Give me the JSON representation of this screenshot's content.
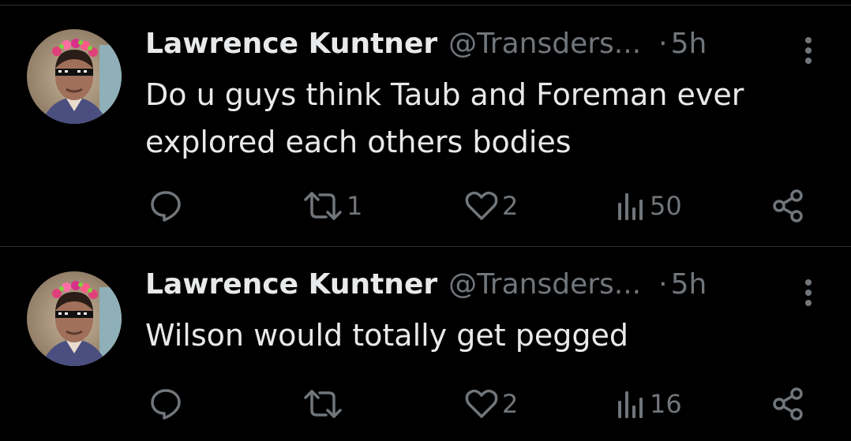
{
  "tweets": [
    {
      "name": "Lawrence Kuntner",
      "handle": "@Transders...",
      "separator": "·",
      "time": "5h",
      "text": "Do u guys think Taub and Foreman ever explored each others bodies",
      "retweets": "1",
      "likes": "2",
      "views": "50"
    },
    {
      "name": "Lawrence Kuntner",
      "handle": "@Transders...",
      "separator": "·",
      "time": "5h",
      "text": "Wilson would totally get pegged",
      "retweets": "",
      "likes": "2",
      "views": "16"
    }
  ],
  "colors": {
    "background": "#000000",
    "primary_text": "#e7e9ea",
    "secondary_text": "#71767b",
    "divider": "#2f3336"
  },
  "icons": [
    "avatar",
    "more-icon",
    "reply-icon",
    "retweet-icon",
    "like-icon",
    "views-icon",
    "share-icon"
  ]
}
